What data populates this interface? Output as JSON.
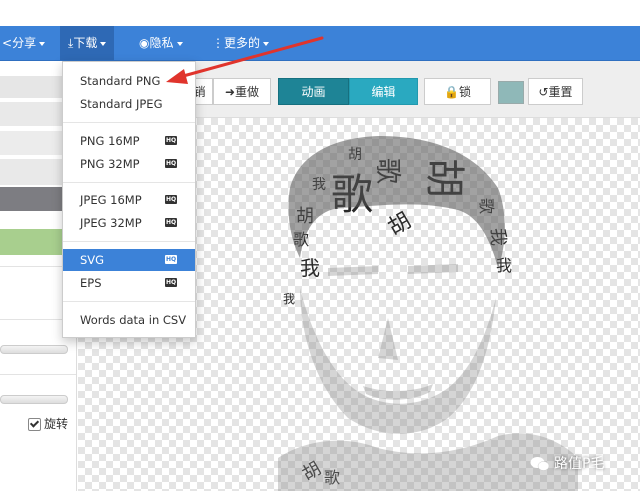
{
  "nav": {
    "share": "分享",
    "download": "下载",
    "privacy": "隐私",
    "more": "更多的"
  },
  "dropdown": {
    "items": [
      {
        "label": "Standard PNG",
        "hq": false,
        "selected": false
      },
      {
        "label": "Standard JPEG",
        "hq": false,
        "selected": false
      },
      {
        "label": "PNG 16MP",
        "hq": true,
        "selected": false
      },
      {
        "label": "PNG 32MP",
        "hq": true,
        "selected": false
      },
      {
        "label": "JPEG 16MP",
        "hq": true,
        "selected": false
      },
      {
        "label": "JPEG 32MP",
        "hq": true,
        "selected": false
      },
      {
        "label": "SVG",
        "hq": true,
        "selected": true
      },
      {
        "label": "EPS",
        "hq": true,
        "selected": false
      },
      {
        "label": "Words data in CSV",
        "hq": false,
        "selected": false
      }
    ],
    "hq_badge": "HQ"
  },
  "toolbar": {
    "undo_tail": "销",
    "redo": "重做",
    "animate": "动画",
    "edit": "编辑",
    "lock": "锁",
    "reset": "重置"
  },
  "left_panel": {
    "rotate_label": "旋转",
    "rotate_checked": true
  },
  "canvas_words": [
    "歌",
    "胡",
    "我",
    "我",
    "歌",
    "胡",
    "胡",
    "歌",
    "我",
    "我",
    "歌",
    "胡",
    "胡",
    "歌",
    "我"
  ],
  "watermark": "路值P毛",
  "colors": {
    "nav_blue": "#3c82d8",
    "nav_active": "#2e69b5",
    "toolbar_active": "#1e8496",
    "toolbar_teal": "#2aa9c0",
    "arrow_red": "#e0342c",
    "swatch": "#8fb8b8"
  }
}
